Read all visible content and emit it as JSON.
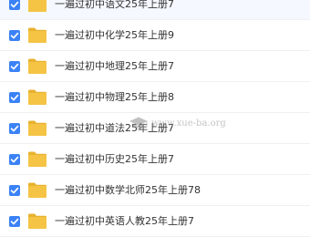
{
  "files": [
    {
      "name": "一遍过初中语文25年上册7",
      "checked": true
    },
    {
      "name": "一遍过初中化学25年上册9",
      "checked": true
    },
    {
      "name": "一遍过初中地理25年上册7",
      "checked": true
    },
    {
      "name": "一遍过初中物理25年上册8",
      "checked": true
    },
    {
      "name": "一遍过初中道法25年上册7",
      "checked": true
    },
    {
      "name": "一遍过初中历史25年上册7",
      "checked": true
    },
    {
      "name": "一遍过初中数学北师25年上册78",
      "checked": true
    },
    {
      "name": "一遍过初中英语人教25年上册7",
      "checked": true
    }
  ],
  "icons": {
    "checkbox": "checkmark-icon",
    "folder": "folder-icon"
  },
  "colors": {
    "checkbox": "#3b82f6",
    "folder": "#f5c445",
    "folder_tab": "#e8b22e",
    "text": "#333333"
  },
  "watermark": {
    "text": "www.xue-ba.org"
  }
}
